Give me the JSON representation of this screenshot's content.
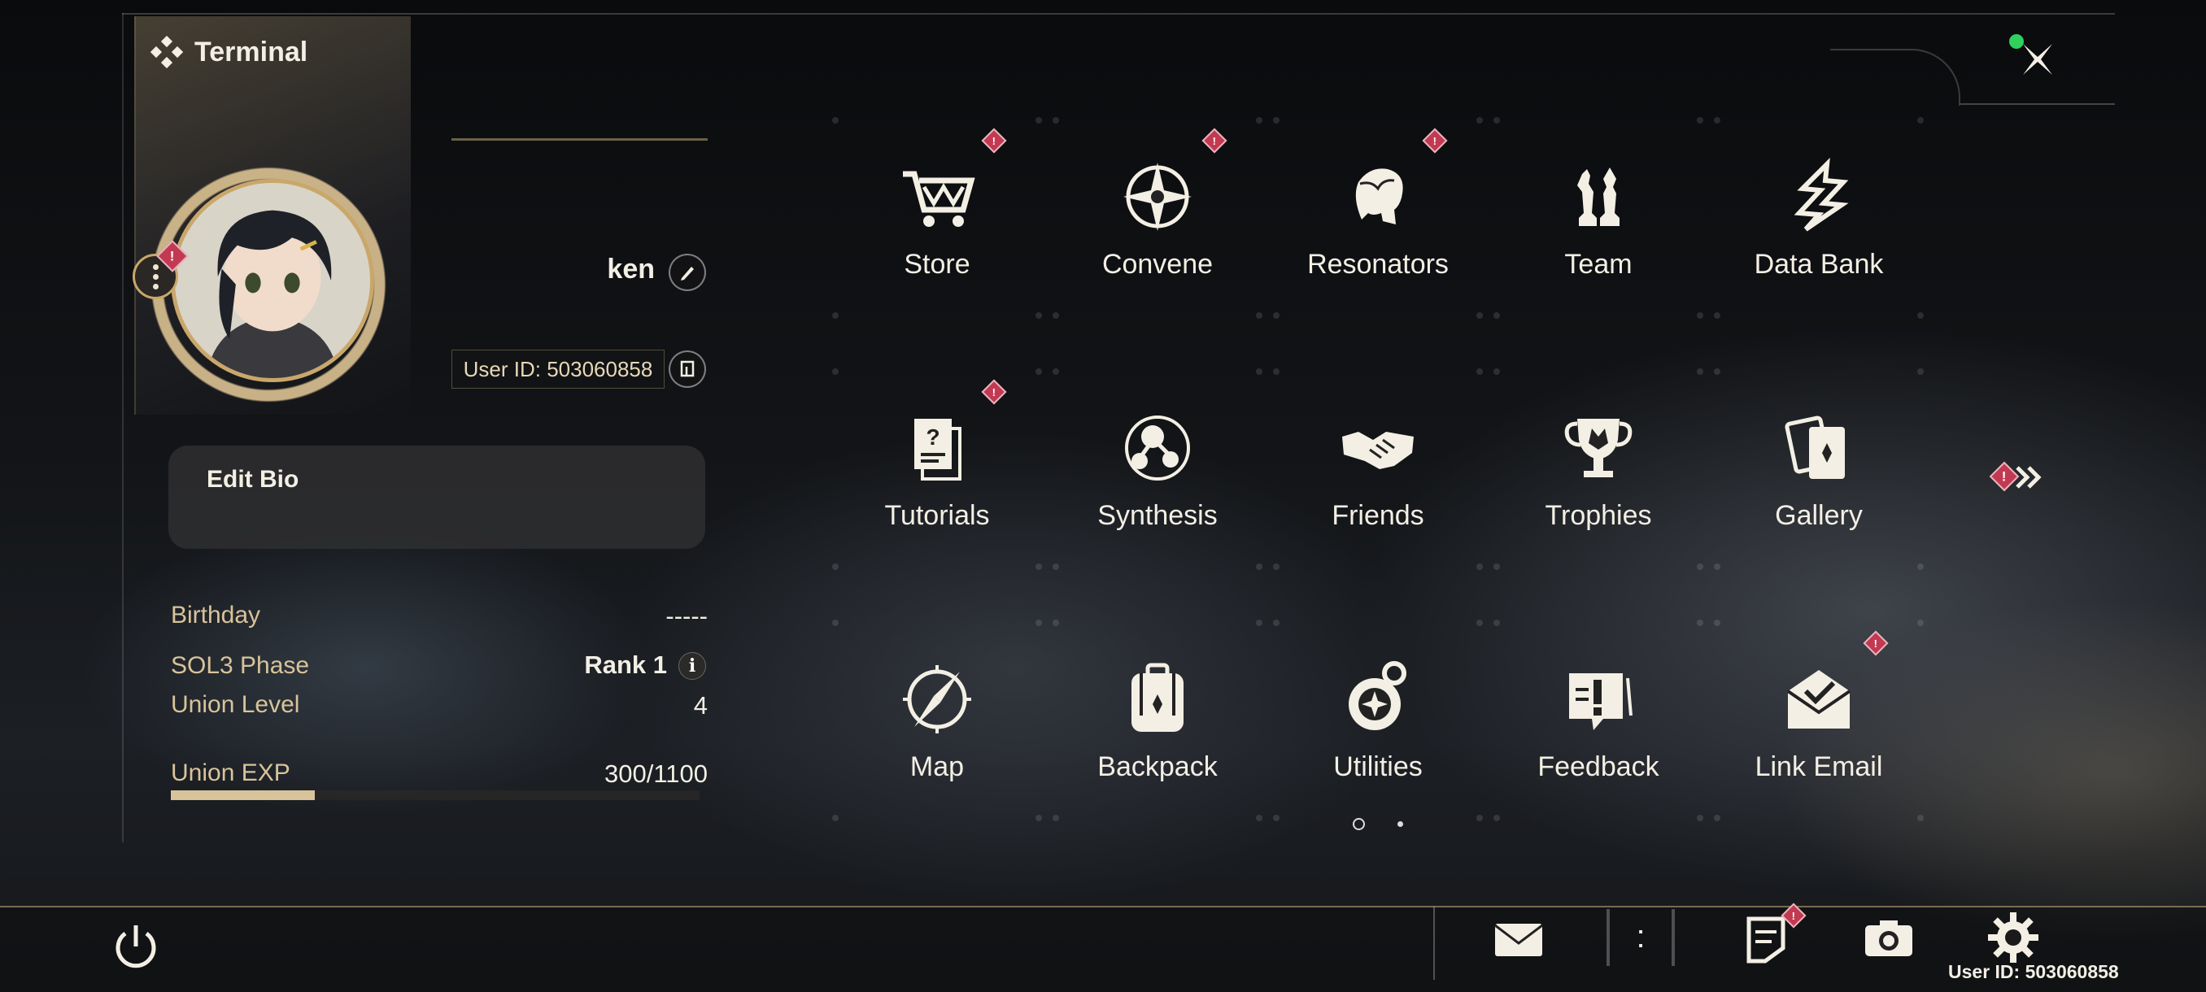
{
  "header": {
    "title": "Terminal",
    "close_icon": "close-x-icon",
    "online_status_color": "#2fd15c"
  },
  "profile": {
    "username": "ken",
    "user_id_label": "User ID: 503060858",
    "bio_placeholder": "Edit Bio",
    "stats": {
      "birthday_label": "Birthday",
      "birthday_value": "-----",
      "sol3_label": "SOL3 Phase",
      "sol3_value": "Rank 1",
      "union_level_label": "Union Level",
      "union_level_value": "4",
      "union_exp_label": "Union EXP",
      "union_exp_value": "300/1100",
      "union_exp_fraction": 0.2727
    },
    "info_glyph": "i",
    "badge_glyph": "!"
  },
  "menu": {
    "items": [
      {
        "id": "store",
        "label": "Store",
        "icon": "shopping-cart-icon",
        "badge": true
      },
      {
        "id": "convene",
        "label": "Convene",
        "icon": "compass-star-icon",
        "badge": true
      },
      {
        "id": "resonators",
        "label": "Resonators",
        "icon": "character-head-icon",
        "badge": true
      },
      {
        "id": "team",
        "label": "Team",
        "icon": "chess-figures-icon",
        "badge": false
      },
      {
        "id": "data-bank",
        "label": "Data Bank",
        "icon": "data-bank-icon",
        "badge": false
      },
      {
        "id": "tutorials",
        "label": "Tutorials",
        "icon": "question-document-icon",
        "badge": true
      },
      {
        "id": "synthesis",
        "label": "Synthesis",
        "icon": "molecule-icon",
        "badge": false
      },
      {
        "id": "friends",
        "label": "Friends",
        "icon": "handshake-icon",
        "badge": false
      },
      {
        "id": "trophies",
        "label": "Trophies",
        "icon": "trophy-icon",
        "badge": false
      },
      {
        "id": "gallery",
        "label": "Gallery",
        "icon": "cards-icon",
        "badge": false
      },
      {
        "id": "map",
        "label": "Map",
        "icon": "map-compass-icon",
        "badge": false
      },
      {
        "id": "backpack",
        "label": "Backpack",
        "icon": "backpack-icon",
        "badge": false
      },
      {
        "id": "utilities",
        "label": "Utilities",
        "icon": "utilities-icon",
        "badge": false
      },
      {
        "id": "feedback",
        "label": "Feedback",
        "icon": "feedback-icon",
        "badge": false
      },
      {
        "id": "link-email",
        "label": "Link Email",
        "icon": "envelope-check-icon",
        "badge": true
      }
    ],
    "pages": {
      "current": 1,
      "total": 2
    }
  },
  "bottom_bar": {
    "user_id_label": "User ID: 503060858",
    "icons": [
      "power-icon",
      "mail-icon",
      "chat-bracket-icon",
      "notice-icon",
      "camera-icon",
      "settings-gear-icon"
    ],
    "chat_glyph": ":"
  },
  "colors": {
    "accent_gold": "#d8c39a",
    "badge_red": "#c23a52",
    "text_light": "#f3efe4"
  }
}
